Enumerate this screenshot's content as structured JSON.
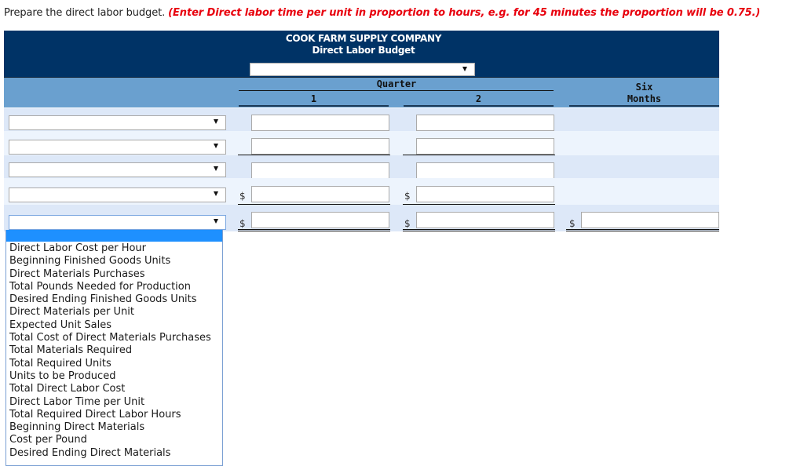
{
  "instructions": {
    "text": "Prepare the direct labor budget.",
    "note": "(Enter Direct labor time per unit in proportion to hours, e.g. for 45 minutes the proportion will be 0.75.)"
  },
  "header": {
    "company": "COOK FARM SUPPLY COMPANY",
    "title": "Direct Labor Budget",
    "period_select_value": ""
  },
  "columns": {
    "group_label": "Quarter",
    "q1": "1",
    "q2": "2",
    "total_line1": "Six",
    "total_line2": "Months"
  },
  "currency_symbol": "$",
  "rows": [
    {
      "label_value": "",
      "q1": "",
      "q2": "",
      "dollar": false
    },
    {
      "label_value": "",
      "q1": "",
      "q2": "",
      "dollar": false
    },
    {
      "label_value": "",
      "q1": "",
      "q2": "",
      "dollar": false
    },
    {
      "label_value": "",
      "q1": "",
      "q2": "",
      "dollar": true
    },
    {
      "label_value": "",
      "q1": "",
      "q2": "",
      "total": "",
      "dollar": true
    }
  ],
  "dropdown": {
    "open_for_row": 5,
    "highlighted_option": "",
    "options": [
      "Direct Labor Cost per Hour",
      "Beginning Finished Goods Units",
      "Direct Materials Purchases",
      "Total Pounds Needed for Production",
      "Desired Ending Finished Goods Units",
      "Direct Materials per Unit",
      "Expected Unit Sales",
      "Total Cost of Direct Materials Purchases",
      "Total Materials Required",
      "Total Required Units",
      "Units to be Produced",
      "Total Direct Labor Cost",
      "Direct Labor Time per Unit",
      "Total Required Direct Labor Hours",
      "Beginning Direct Materials",
      "Cost per Pound",
      "Desired Ending Direct Materials"
    ]
  },
  "colors": {
    "header_bg": "#003366",
    "subheader_bg": "#6aa0cf",
    "row_alt_a": "#dde8f8",
    "row_alt_b": "#edf4fd",
    "note_red": "#e8000d",
    "dropdown_highlight": "#1e90ff"
  }
}
